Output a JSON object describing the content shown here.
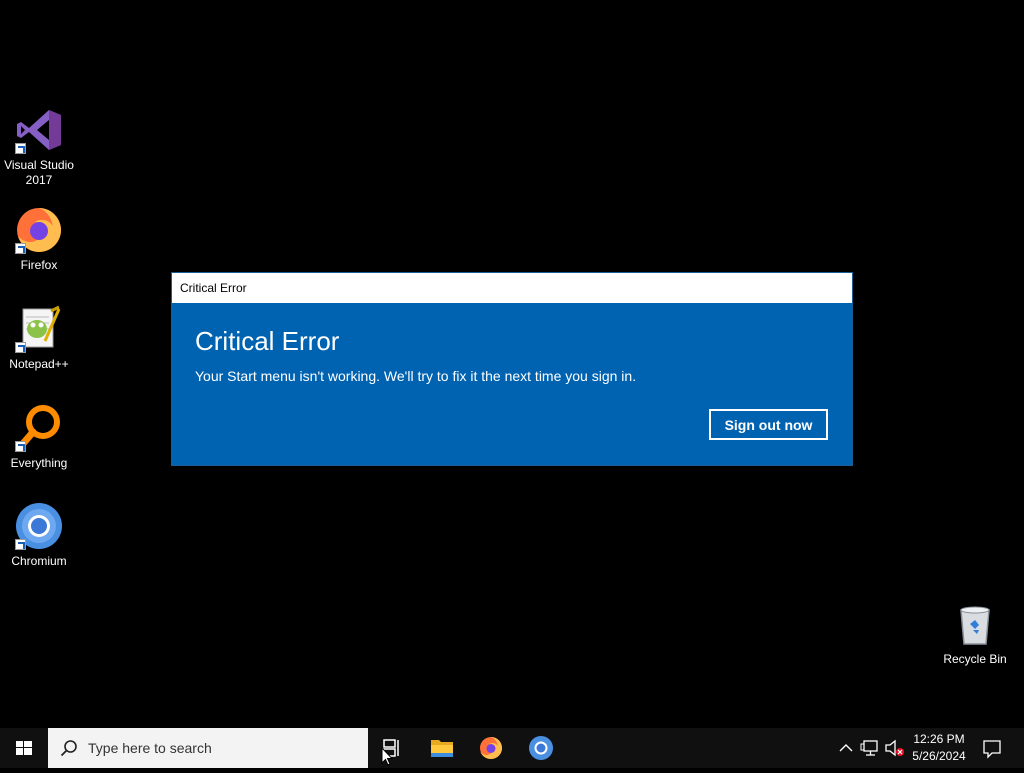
{
  "desktop": {
    "icons": [
      {
        "label": "Visual Studio\n2017",
        "icon": "visual-studio-icon"
      },
      {
        "label": "Firefox",
        "icon": "firefox-icon"
      },
      {
        "label": "Notepad++",
        "icon": "notepad-plus-plus-icon"
      },
      {
        "label": "Everything",
        "icon": "everything-icon"
      },
      {
        "label": "Chromium",
        "icon": "chromium-icon"
      }
    ],
    "recycle_bin": {
      "label": "Recycle Bin",
      "icon": "recycle-bin-icon"
    }
  },
  "dialog": {
    "title": "Critical Error",
    "heading": "Critical Error",
    "message": "Your Start menu isn't working. We'll try to fix it the next time you sign in.",
    "button_label": "Sign out now",
    "accent_color": "#0063b1"
  },
  "taskbar": {
    "search_placeholder": "Type here to search",
    "pinned": [
      "task-view-icon",
      "file-explorer-icon",
      "firefox-icon",
      "chromium-icon"
    ],
    "clock_time": "12:26 PM",
    "clock_date": "5/26/2024"
  }
}
